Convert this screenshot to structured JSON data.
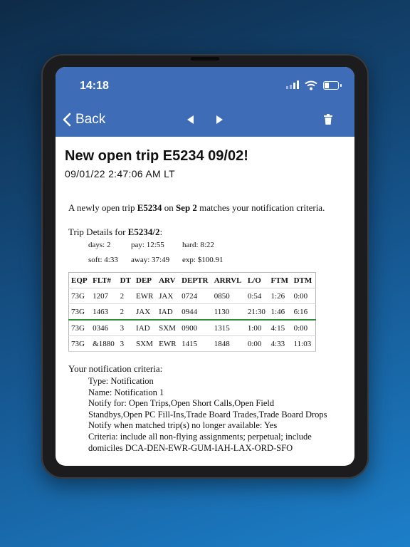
{
  "status_bar": {
    "time": "14:18"
  },
  "nav": {
    "back_label": "Back"
  },
  "header": {
    "title": "New open trip E5234 09/02!",
    "timestamp": "09/01/22 2:47:06 AM LT"
  },
  "message": {
    "intro_prefix": "A newly open trip ",
    "trip_id": "E5234",
    "intro_mid": " on ",
    "date": "Sep 2",
    "intro_suffix": " matches your notification criteria."
  },
  "trip_details": {
    "label": "Trip Details for ",
    "trip_ref": "E5234/2",
    "colon": ":",
    "stats": [
      [
        "days: 2",
        "pay: 12:55",
        "hard: 8:22"
      ],
      [
        "soft: 4:33",
        "away: 37:49",
        "exp: $100.91"
      ]
    ]
  },
  "table": {
    "headers": [
      "EQP",
      "FLT#",
      "DT",
      "DEP",
      "ARV",
      "DEPTR",
      "ARRVL",
      "L/O",
      "FTM",
      "DTM"
    ],
    "rows": [
      [
        "73G",
        "1207",
        "2",
        "EWR",
        "JAX",
        "0724",
        "0850",
        "0:54",
        "1:26",
        "0:00"
      ],
      [
        "73G",
        "1463",
        "2",
        "JAX",
        "IAD",
        "0944",
        "1130",
        "21:30",
        "1:46",
        "6:16"
      ],
      [
        "73G",
        "0346",
        "3",
        "IAD",
        "SXM",
        "0900",
        "1315",
        "1:00",
        "4:15",
        "0:00"
      ],
      [
        "73G",
        "&1880",
        "3",
        "SXM",
        "EWR",
        "1415",
        "1848",
        "0:00",
        "4:33",
        "11:03"
      ]
    ]
  },
  "criteria": {
    "heading": "Your notification criteria:",
    "lines": [
      "Type: Notification",
      "Name: Notification 1",
      "Notify for: Open Trips,Open Short Calls,Open Field Standbys,Open PC Fill-Ins,Trade Board Trades,Trade Board Drops",
      "Notify when matched trip(s) no longer available: Yes",
      "Criteria: include all non-flying assignments; perpetual; include domiciles DCA-DEN-EWR-GUM-IAH-LAX-ORD-SFO"
    ]
  },
  "icons": {
    "back": "chevron-left-icon",
    "prev": "triangle-left-icon",
    "next": "triangle-right-icon",
    "delete": "trash-icon"
  },
  "colors": {
    "nav_bar": "#3e6cb6",
    "highlight_row": "#2d8c3c"
  }
}
